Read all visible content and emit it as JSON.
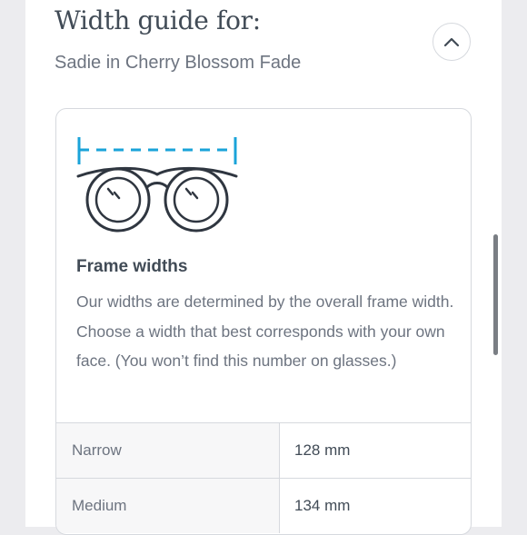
{
  "header": {
    "title": "Width guide for:",
    "subtitle": "Sadie in Cherry Blossom Fade"
  },
  "card": {
    "heading": "Frame widths",
    "description": "Our widths are determined by the overall frame width. Choose a width that best corresponds with your own face. (You won’t find this number on glasses.)"
  },
  "widths": [
    {
      "name": "Narrow",
      "value": "128 mm"
    },
    {
      "name": "Medium",
      "value": "134 mm"
    }
  ],
  "icons": {
    "collapse": "chevron-up-icon",
    "illustration": "glasses-width-icon"
  },
  "colors": {
    "accent": "#1aa3d9",
    "text": "#414b56",
    "muted": "#6d7480",
    "border": "#d6d9de"
  }
}
